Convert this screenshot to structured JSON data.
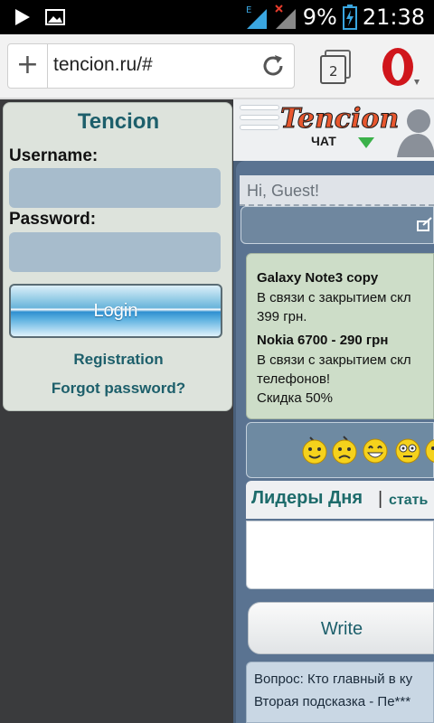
{
  "status_bar": {
    "icons": [
      "play-icon",
      "image-icon",
      "signal-e-icon",
      "signal-x-icon",
      "battery-icon"
    ],
    "signal_label": "E",
    "battery_percent": "9%",
    "time": "21:38"
  },
  "browser": {
    "url": "tencion.ru/#",
    "tab_count": "2"
  },
  "login": {
    "title": "Tencion",
    "username_label": "Username:",
    "username_value": "",
    "password_label": "Password:",
    "password_value": "",
    "login_button": "Login",
    "registration_link": "Registration",
    "forgot_link": "Forgot password?"
  },
  "site": {
    "logo_text": "Tencion",
    "logo_sub": "ЧАТ",
    "greeting": "Hi, Guest!"
  },
  "ads": [
    {
      "title": "Galaxy Note3 copy",
      "lines": [
        "В связи с закрытием скл",
        "399 грн."
      ]
    },
    {
      "title": "Nokia 6700 - 290 грн",
      "lines": [
        "В связи с закрытием скл",
        "телефонов!",
        "Скидка 50%"
      ]
    }
  ],
  "smileys": [
    "smiley-icon",
    "smiley-sad-icon",
    "smiley-grin-icon",
    "smiley-eyes-icon",
    "smiley-surprised-icon"
  ],
  "leaders": {
    "title": "Лидеры Дня",
    "separator": "|",
    "link": "стать"
  },
  "write_button": "Write",
  "quiz": {
    "line1": "Вопрос: Кто главный в ку",
    "line2": "Вторая подсказка - Пе***"
  },
  "colors": {
    "accent_teal": "#1d5f6b",
    "panel_bg": "#dde3dc",
    "input_bg": "#a7bccc",
    "frame_blue": "#5a7391"
  }
}
